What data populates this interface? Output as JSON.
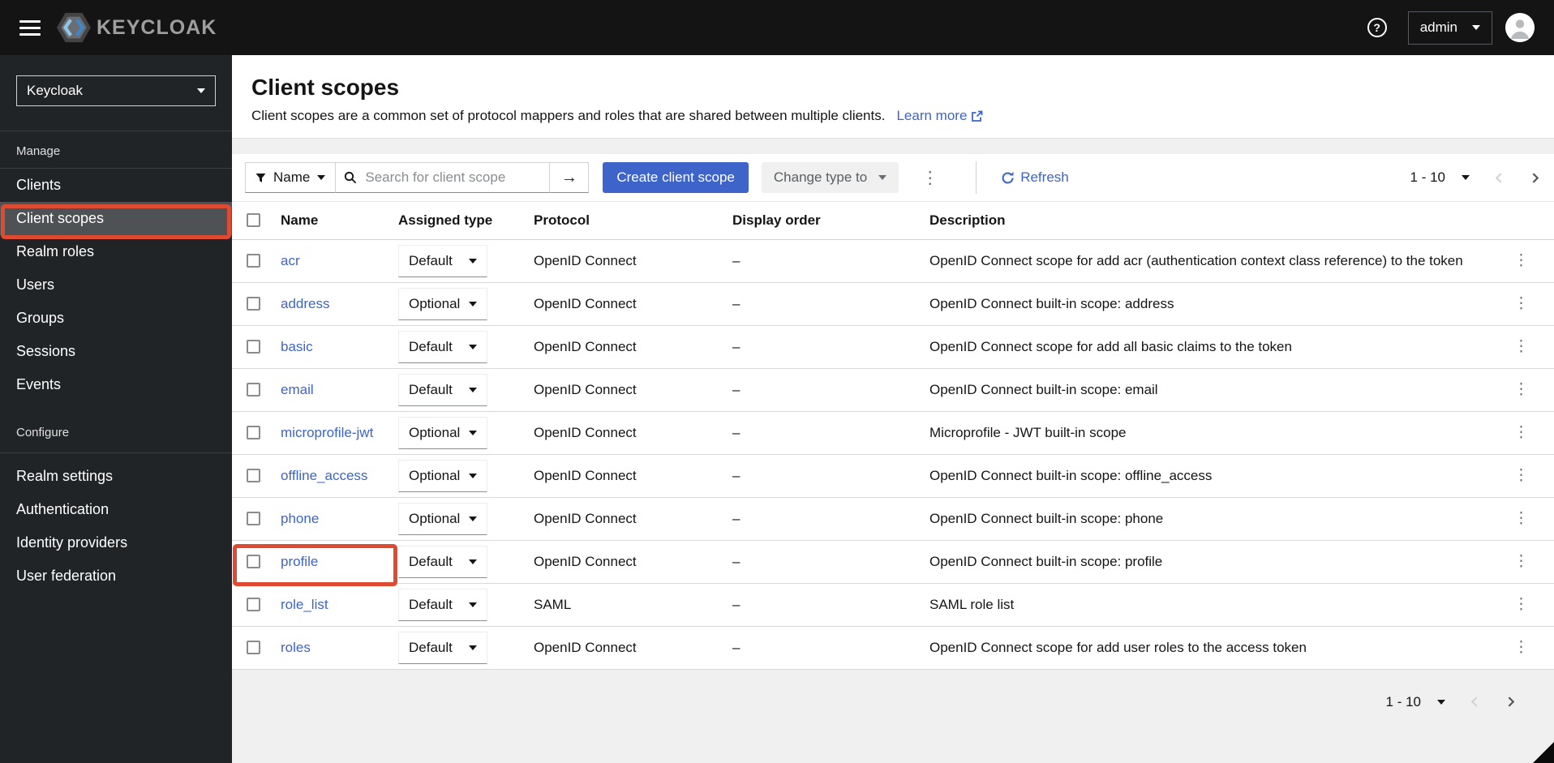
{
  "topbar": {
    "brand": "KEYCLOAK",
    "user": "admin"
  },
  "icons": {
    "help": "?",
    "forward_arrow": "→",
    "kebab": "⋮"
  },
  "sidebar": {
    "realm_selector": "Keycloak",
    "manage_label": "Manage",
    "manage_items": [
      {
        "label": "Clients",
        "selected": false
      },
      {
        "label": "Client scopes",
        "selected": true
      },
      {
        "label": "Realm roles",
        "selected": false
      },
      {
        "label": "Users",
        "selected": false
      },
      {
        "label": "Groups",
        "selected": false
      },
      {
        "label": "Sessions",
        "selected": false
      },
      {
        "label": "Events",
        "selected": false
      }
    ],
    "configure_label": "Configure",
    "configure_items": [
      {
        "label": "Realm settings",
        "selected": false
      },
      {
        "label": "Authentication",
        "selected": false
      },
      {
        "label": "Identity providers",
        "selected": false
      },
      {
        "label": "User federation",
        "selected": false
      }
    ]
  },
  "header": {
    "title": "Client scopes",
    "description": "Client scopes are a common set of protocol mappers and roles that are shared between multiple clients.",
    "learn_more": "Learn more"
  },
  "toolbar": {
    "filter_label": "Name",
    "search_placeholder": "Search for client scope",
    "create_button": "Create client scope",
    "change_type_button": "Change type to",
    "refresh_label": "Refresh",
    "pagination": "1 - 10"
  },
  "table": {
    "columns": [
      "Name",
      "Assigned type",
      "Protocol",
      "Display order",
      "Description"
    ],
    "rows": [
      {
        "name": "acr",
        "assigned_type": "Default",
        "protocol": "OpenID Connect",
        "display_order": "–",
        "description": "OpenID Connect scope for add acr (authentication context class reference) to the token",
        "highlighted": false
      },
      {
        "name": "address",
        "assigned_type": "Optional",
        "protocol": "OpenID Connect",
        "display_order": "–",
        "description": "OpenID Connect built-in scope: address",
        "highlighted": false
      },
      {
        "name": "basic",
        "assigned_type": "Default",
        "protocol": "OpenID Connect",
        "display_order": "–",
        "description": "OpenID Connect scope for add all basic claims to the token",
        "highlighted": false
      },
      {
        "name": "email",
        "assigned_type": "Default",
        "protocol": "OpenID Connect",
        "display_order": "–",
        "description": "OpenID Connect built-in scope: email",
        "highlighted": false
      },
      {
        "name": "microprofile-jwt",
        "assigned_type": "Optional",
        "protocol": "OpenID Connect",
        "display_order": "–",
        "description": "Microprofile - JWT built-in scope",
        "highlighted": false
      },
      {
        "name": "offline_access",
        "assigned_type": "Optional",
        "protocol": "OpenID Connect",
        "display_order": "–",
        "description": "OpenID Connect built-in scope: offline_access",
        "highlighted": false
      },
      {
        "name": "phone",
        "assigned_type": "Optional",
        "protocol": "OpenID Connect",
        "display_order": "–",
        "description": "OpenID Connect built-in scope: phone",
        "highlighted": false
      },
      {
        "name": "profile",
        "assigned_type": "Default",
        "protocol": "OpenID Connect",
        "display_order": "–",
        "description": "OpenID Connect built-in scope: profile",
        "highlighted": true
      },
      {
        "name": "role_list",
        "assigned_type": "Default",
        "protocol": "SAML",
        "display_order": "–",
        "description": "SAML role list",
        "highlighted": false
      },
      {
        "name": "roles",
        "assigned_type": "Default",
        "protocol": "OpenID Connect",
        "display_order": "–",
        "description": "OpenID Connect scope for add user roles to the access token",
        "highlighted": false
      }
    ]
  },
  "footer": {
    "pagination": "1 - 10"
  },
  "annotations": {
    "color": "#dc4b32",
    "highlighted_sidebar_item": "Client scopes",
    "highlighted_row": "profile"
  },
  "colors": {
    "primary_button_blue": "#3e63c9",
    "link_blue": "#3d64c9",
    "topbar_background": "#141414",
    "sidebar_background": "#212427",
    "selected_nav_background": "#4f5255",
    "annotation_red": "#dc4b32"
  }
}
